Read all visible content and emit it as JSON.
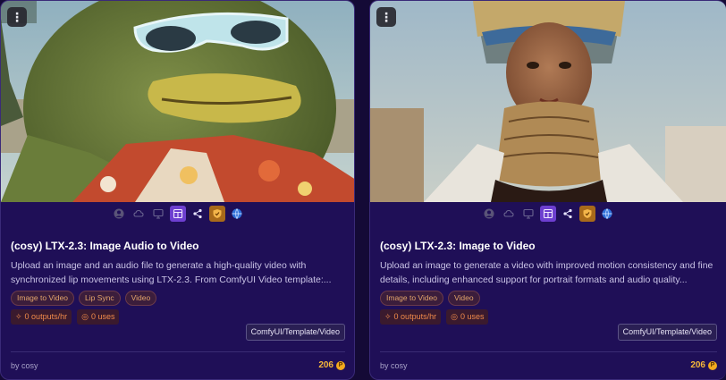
{
  "colors": {
    "page_bg": "#140a36",
    "card_bg": "#1f0f57",
    "accent_orange": "#f08a4a",
    "price_gold": "#f5b63a",
    "tag_text": "#e3a56a"
  },
  "cards": [
    {
      "menu_icon": "more-vertical-icon",
      "thumbnail_label": "frog-sunglasses-thumbnail",
      "icons": [
        "user-icon",
        "cloud-icon",
        "monitor-icon",
        "template-icon",
        "share-icon",
        "shield-icon",
        "globe-icon"
      ],
      "title": "(cosy) LTX-2.3: Image Audio to Video",
      "description": "Upload an image and an audio file to generate a high-quality video with synchronized lip movements using LTX-2.3. From ComfyUI Video template:...",
      "tags": [
        "Image to Video",
        "Lip Sync",
        "Video"
      ],
      "stats": {
        "outputs": "0 outputs/hr",
        "uses": "0 uses"
      },
      "source": "ComfyUI/Template/Video",
      "author": "by cosy",
      "price": "206",
      "coin_symbol": "P"
    },
    {
      "menu_icon": "more-vertical-icon",
      "thumbnail_label": "woman-headdress-thumbnail",
      "icons": [
        "user-icon",
        "cloud-icon",
        "monitor-icon",
        "template-icon",
        "share-icon",
        "shield-icon",
        "globe-icon"
      ],
      "title": "(cosy) LTX-2.3: Image to Video",
      "description": "Upload an image to generate a video with improved motion consistency and fine details, including enhanced support for portrait formats and audio quality...",
      "tags": [
        "Image to Video",
        "Video"
      ],
      "stats": {
        "outputs": "0 outputs/hr",
        "uses": "0 uses"
      },
      "source": "ComfyUI/Template/Video",
      "author": "by cosy",
      "price": "206",
      "coin_symbol": "P"
    }
  ]
}
